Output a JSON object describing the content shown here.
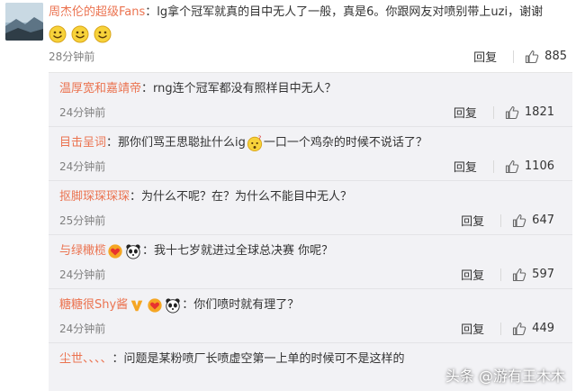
{
  "colors": {
    "username": "#eb7350",
    "reply_bg": "#f2f2f5",
    "time": "#808080"
  },
  "main_comment": {
    "username": "周杰伦的超级Fans",
    "text": "：lg拿个冠军就真的目中无人了一般，真是6。你跟网友对喷别带上uzi，谢谢",
    "emoji_icons": [
      "smile-face-icon",
      "smile-face-icon",
      "smile-face-icon"
    ],
    "time": "28分钟前",
    "reply_label": "回复",
    "likes": "885"
  },
  "replies": [
    {
      "username": "温厚宽和嘉靖帝",
      "text": "：rng连个冠军都没有照样目中无人？",
      "time": "24分钟前",
      "reply_label": "回复",
      "likes": "1821"
    },
    {
      "username": "目击呈词",
      "text_before": "：那你们骂王思聪扯什么ig",
      "text_after": "一口一个鸡杂的时候不说话了？",
      "inline_icon": "confused-face-icon",
      "time": "24分钟前",
      "reply_label": "回复",
      "likes": "1106"
    },
    {
      "username": "抠脚琛琛琛琛",
      "text": "：为什么不呢？在？为什么不能目中无人？",
      "time": "25分钟前",
      "reply_label": "回复",
      "likes": "647"
    },
    {
      "username": "与绿橄榄",
      "badge_icons": [
        "heart-badge-icon",
        "panda-icon"
      ],
      "text": "：我十七岁就进过全球总决赛 你呢？",
      "time": "24分钟前",
      "reply_label": "回复",
      "likes": "597"
    },
    {
      "username": "糖糖很Shy酱",
      "badge_icons": [
        "v-badge-icon",
        "heart-badge-icon",
        "panda-icon"
      ],
      "text": "：你们喷时就有理了？",
      "time": "24分钟前",
      "reply_label": "回复",
      "likes": "449"
    },
    {
      "username": "尘世、、、、",
      "text": "：问题是某粉喷厂长喷虚空第一上单的时候可不是这样的",
      "time": "",
      "reply_label": "",
      "likes": ""
    }
  ],
  "watermark": "头条 @游有王木木"
}
